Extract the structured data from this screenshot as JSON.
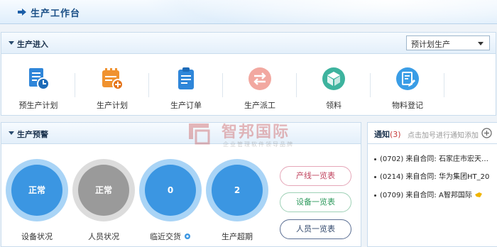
{
  "header": {
    "title": "生产工作台"
  },
  "entry": {
    "title": "生产进入",
    "select_value": "预计划生产",
    "tiles": [
      {
        "label": "预生产计划",
        "icon": "doc-clock-icon",
        "color": "#2f86d9"
      },
      {
        "label": "生产计划",
        "icon": "calendar-add-icon",
        "color": "#f0922f"
      },
      {
        "label": "生产订单",
        "icon": "clipboard-icon",
        "color": "#2f86d9"
      },
      {
        "label": "生产派工",
        "icon": "swap-arrows-icon",
        "color": "#f2a8a0"
      },
      {
        "label": "领料",
        "icon": "box-icon",
        "color": "#3db39e"
      },
      {
        "label": "物料登记",
        "icon": "edit-doc-icon",
        "color": "#3a9de6"
      }
    ]
  },
  "warning": {
    "title": "生产预警",
    "circles": [
      {
        "value": "正常",
        "label": "设备状况",
        "color": "blue"
      },
      {
        "value": "正常",
        "label": "人员状况",
        "color": "gray"
      },
      {
        "value": "0",
        "label": "临近交货",
        "color": "blue"
      },
      {
        "value": "2",
        "label": "生产超期",
        "color": "blue"
      }
    ],
    "buttons": [
      "产线一览表",
      "设备一览表",
      "人员一览表"
    ]
  },
  "notice": {
    "title": "通知",
    "count": "(3)",
    "hint": "点击加号进行通知添加",
    "items": [
      "(0702) 来自合同: 石家庄市宏天…",
      "(0214) 来自合同: 华为集团HT_20",
      "(0709) 来自合同: A智邦国际"
    ]
  },
  "watermark": {
    "name": "智邦国际",
    "sub": "企业管理软件领导品牌"
  }
}
